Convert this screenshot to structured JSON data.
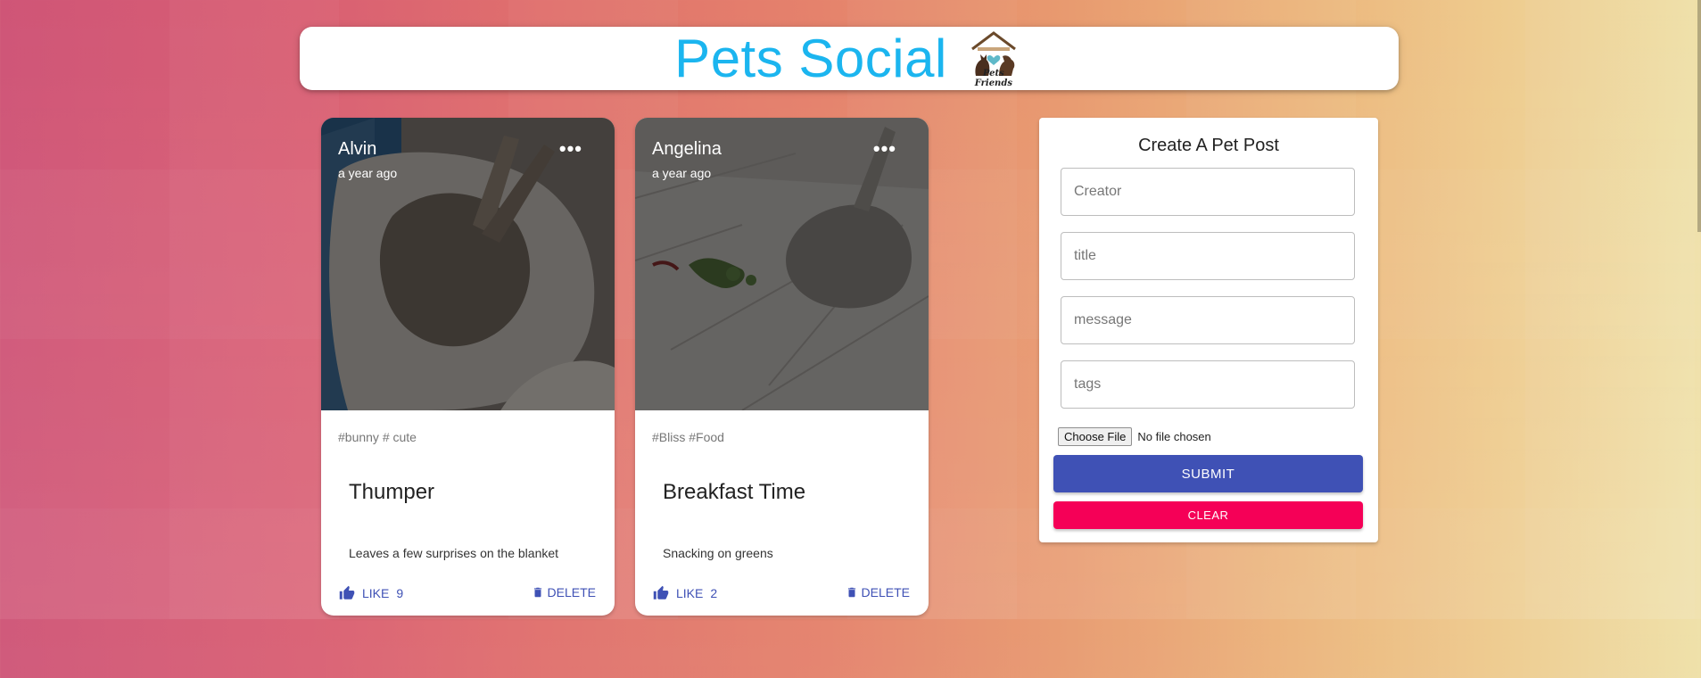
{
  "header": {
    "title": "Pets Social",
    "logo_text": "Pets Friends"
  },
  "posts": [
    {
      "creator": "Alvin",
      "time": "a year ago",
      "tags": "#bunny # cute",
      "title": "Thumper",
      "message": "Leaves a few surprises on the blanket",
      "like_label": "LIKE",
      "like_count": "9",
      "delete_label": "DELETE"
    },
    {
      "creator": "Angelina",
      "time": "a year ago",
      "tags": "#Bliss #Food",
      "title": "Breakfast Time",
      "message": "Snacking on greens",
      "like_label": "LIKE",
      "like_count": "2",
      "delete_label": "DELETE"
    }
  ],
  "form": {
    "title": "Create A Pet Post",
    "creator_placeholder": "Creator",
    "title_placeholder": "title",
    "message_placeholder": "message",
    "tags_placeholder": "tags",
    "file_button": "Choose File",
    "file_status": "No file chosen",
    "submit_label": "SUBMIT",
    "clear_label": "CLEAR"
  },
  "colors": {
    "brand": "#1bb5ef",
    "primary": "#3f51b5",
    "secondary": "#f50057"
  }
}
